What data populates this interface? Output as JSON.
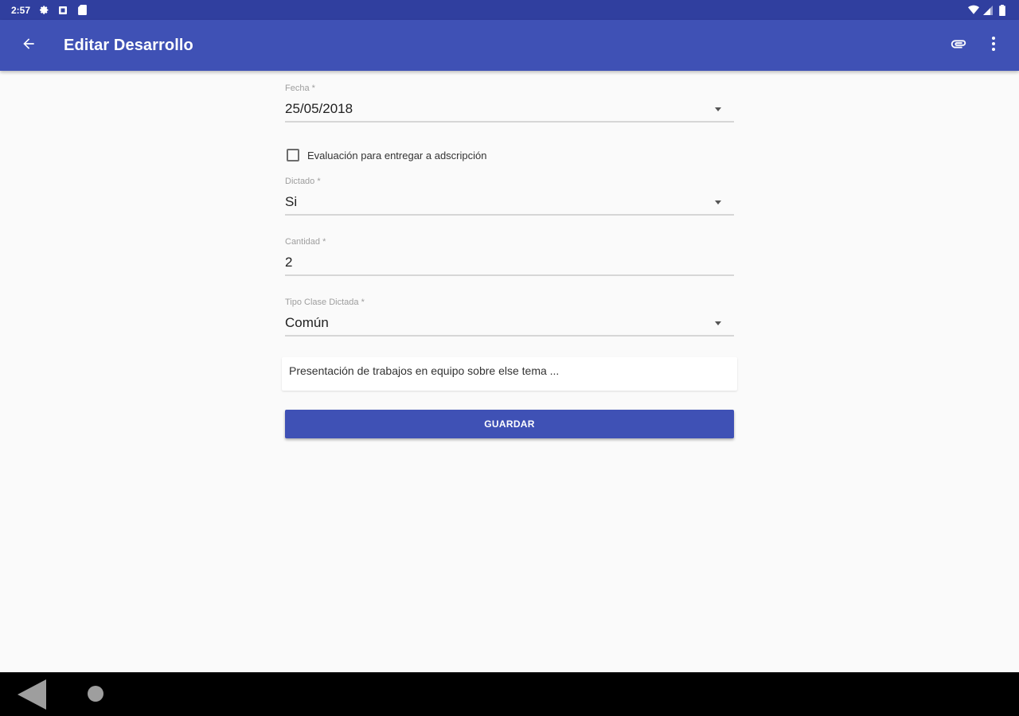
{
  "status_bar": {
    "time": "2:57",
    "icons": [
      "settings-icon",
      "notification-icon",
      "sd-card-icon",
      "wifi-icon",
      "signal-icon",
      "battery-icon"
    ]
  },
  "app_bar": {
    "title": "Editar Desarrollo",
    "back_icon": "arrow-back-icon",
    "actions": [
      "attach-icon",
      "more-vert-icon"
    ],
    "color": "#3f51b5",
    "status_color": "#303f9f"
  },
  "form": {
    "fecha": {
      "label": "Fecha *",
      "value": "25/05/2018"
    },
    "checkbox": {
      "label": "Evaluación para entregar a adscripción",
      "checked": false
    },
    "dictado": {
      "label": "Dictado *",
      "value": "Si"
    },
    "cantidad": {
      "label": "Cantidad *",
      "value": "2"
    },
    "tipo_clase": {
      "label": "Tipo Clase Dictada *",
      "value": "Común"
    },
    "observaciones": {
      "value": "Presentación de trabajos en equipo sobre else tema ..."
    },
    "save_label": "GUARDAR"
  },
  "nav_bar": {
    "icons": [
      "nav-back-icon",
      "nav-home-icon"
    ]
  }
}
